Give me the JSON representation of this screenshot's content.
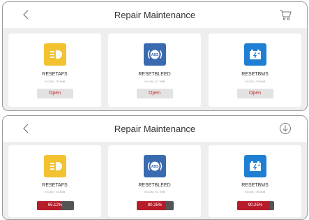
{
  "colors": {
    "afs": "#f2c230",
    "bleed": "#3a6bb0",
    "bms": "#1f7fd3",
    "progress_fill": "#b71c2a",
    "progress_track": "#555555",
    "open_text": "#c62828"
  },
  "panel_top": {
    "title": "Repair Maintenance",
    "right_icon": "cart-icon",
    "cards": [
      {
        "name": "RESETAFS",
        "version": "V10.80 | 70.3MB",
        "icon": "headlight-icon",
        "button": "Open"
      },
      {
        "name": "RESETBLEED",
        "version": "V10.80 | 67.7MB",
        "icon": "abs-icon",
        "button": "Open"
      },
      {
        "name": "RESETBMS",
        "version": "V10.80 | 79.6MB",
        "icon": "battery-icon",
        "button": "Open"
      }
    ]
  },
  "panel_bottom": {
    "title": "Repair Maintenance",
    "right_icon": "download-icon",
    "cards": [
      {
        "name": "RESETAFS",
        "version": "V10.80 | 70.3MB",
        "icon": "headlight-icon",
        "progress": 65.12,
        "progress_label": "65.12%"
      },
      {
        "name": "RESETBLEED",
        "version": "V10.80 | 67.7MB",
        "icon": "abs-icon",
        "progress": 80.25,
        "progress_label": "80.25%"
      },
      {
        "name": "RESETBMS",
        "version": "V10.80 | 79.6MB",
        "icon": "battery-icon",
        "progress": 90.25,
        "progress_label": "90.25%"
      }
    ]
  }
}
